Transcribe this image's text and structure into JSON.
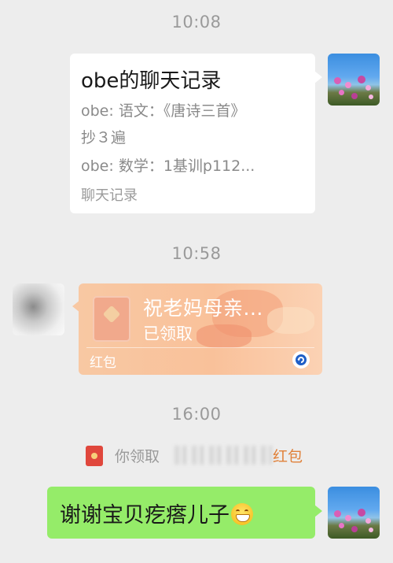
{
  "timestamps": [
    "10:08",
    "10:58",
    "16:00"
  ],
  "chat_record": {
    "title": "obe的聊天记录",
    "lines": [
      "obe: 语文：《唐诗三首》",
      "抄３遍",
      "obe: 数学：1基训p112..."
    ],
    "footer": "聊天记录"
  },
  "red_packet": {
    "title": "祝老妈母亲...",
    "status": "已领取",
    "footer": "红包",
    "badge_icon": "refresh-arrow-icon"
  },
  "system_notice": {
    "prefix": "你领取",
    "link": "红包"
  },
  "my_message": {
    "text": "谢谢宝贝疙瘩儿子",
    "emoji": "grinning-face-icon"
  },
  "colors": {
    "background": "#ededed",
    "green_bubble": "#95ec69",
    "red_packet": "#f8c8a3",
    "link": "#e0813a",
    "timestamp": "#9a9a9a"
  }
}
